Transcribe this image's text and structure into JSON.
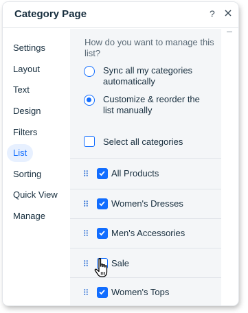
{
  "header": {
    "title": "Category Page",
    "help_label": "?",
    "close_icon": "close-icon"
  },
  "sidebar": {
    "items": [
      {
        "label": "Settings",
        "active": false
      },
      {
        "label": "Layout",
        "active": false
      },
      {
        "label": "Text",
        "active": false
      },
      {
        "label": "Design",
        "active": false
      },
      {
        "label": "Filters",
        "active": false
      },
      {
        "label": "List",
        "active": true
      },
      {
        "label": "Sorting",
        "active": false
      },
      {
        "label": "Quick View",
        "active": false
      },
      {
        "label": "Manage",
        "active": false
      }
    ]
  },
  "content": {
    "question": "How do you want to manage this list?",
    "options": [
      {
        "label": "Sync all my categories automatically",
        "checked": false
      },
      {
        "label": "Customize & reorder the list manually",
        "checked": true
      }
    ],
    "select_all": {
      "label": "Select all categories",
      "checked": false
    },
    "categories": [
      {
        "label": "All Products",
        "checked": true
      },
      {
        "label": "Women's Dresses",
        "checked": true
      },
      {
        "label": "Men's Accessories",
        "checked": true
      },
      {
        "label": "Sale",
        "checked": false
      },
      {
        "label": "Women's Tops",
        "checked": true
      }
    ]
  },
  "colors": {
    "accent": "#116dff",
    "active_nav_bg": "#e7f0ff",
    "content_bg": "#f4f6f8",
    "text": "#162d3d"
  }
}
